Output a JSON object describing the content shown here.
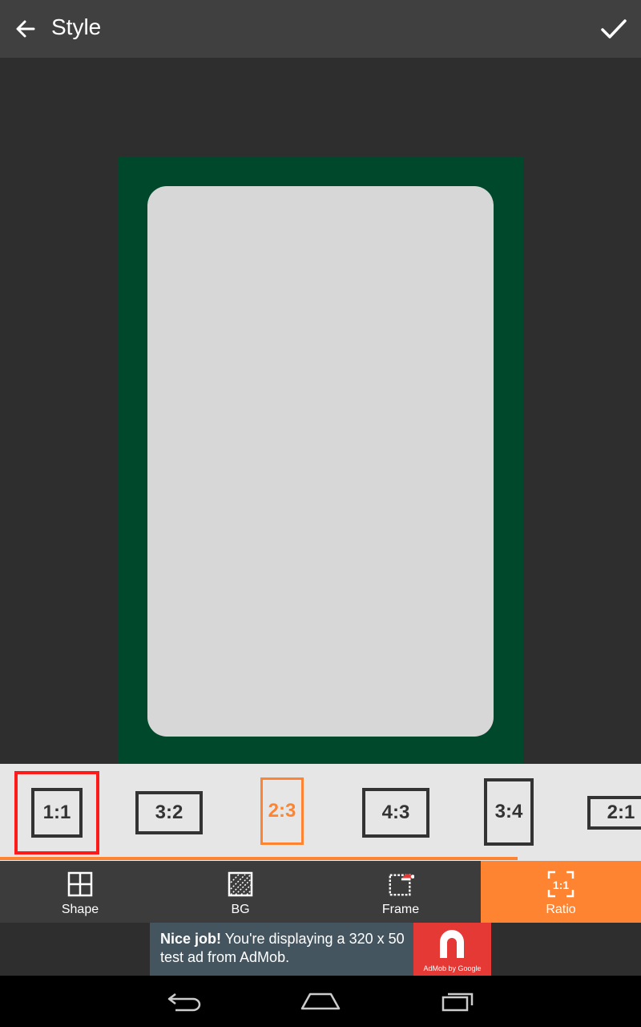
{
  "header": {
    "title": "Style",
    "back_icon": "arrow-left-icon",
    "done_icon": "checkmark-icon"
  },
  "canvas": {
    "frame_color": "#00482c",
    "cell_color": "#d7d7d7"
  },
  "ratios": {
    "items": [
      {
        "label": "1:1",
        "selected_outline": true
      },
      {
        "label": "3:2"
      },
      {
        "label": "2:3",
        "active": true
      },
      {
        "label": "4:3"
      },
      {
        "label": "3:4"
      },
      {
        "label": "2:1"
      }
    ],
    "accent": "#ff8431",
    "outline_color": "#ff1a1a"
  },
  "tabs": [
    {
      "label": "Shape",
      "icon": "grid-icon"
    },
    {
      "label": "BG",
      "icon": "texture-icon"
    },
    {
      "label": "Frame",
      "icon": "frame-icon"
    },
    {
      "label": "Ratio",
      "icon": "ratio-icon",
      "selected": true
    }
  ],
  "ad": {
    "bold": "Nice job!",
    "text": " You're displaying a 320 x 50 test ad from AdMob.",
    "logo_caption": "AdMob by Google",
    "logo_color": "#e53935"
  },
  "navbar": {
    "back_icon": "nav-back-icon",
    "home_icon": "nav-home-icon",
    "recents_icon": "nav-recents-icon"
  }
}
